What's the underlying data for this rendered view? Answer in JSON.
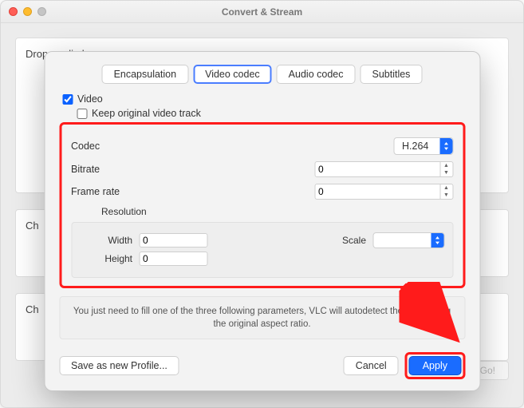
{
  "window": {
    "title": "Convert & Stream"
  },
  "drop_text": "Drop media here",
  "ch_label": "Ch",
  "go_label": "Go!",
  "tabs": {
    "encapsulation": "Encapsulation",
    "video_codec": "Video codec",
    "audio_codec": "Audio codec",
    "subtitles": "Subtitles"
  },
  "checks": {
    "video": "Video",
    "keep": "Keep original video track"
  },
  "fields": {
    "codec": {
      "label": "Codec",
      "value": "H.264"
    },
    "bitrate": {
      "label": "Bitrate",
      "value": "0"
    },
    "framerate": {
      "label": "Frame rate",
      "value": "0"
    },
    "resolution_label": "Resolution",
    "width": {
      "label": "Width",
      "value": "0"
    },
    "height": {
      "label": "Height",
      "value": "0"
    },
    "scale": {
      "label": "Scale",
      "value": ""
    }
  },
  "hint": "You just need to fill one of the three following parameters, VLC will autodetect the other using the original aspect ratio.",
  "buttons": {
    "save_profile": "Save as new Profile...",
    "cancel": "Cancel",
    "apply": "Apply"
  }
}
